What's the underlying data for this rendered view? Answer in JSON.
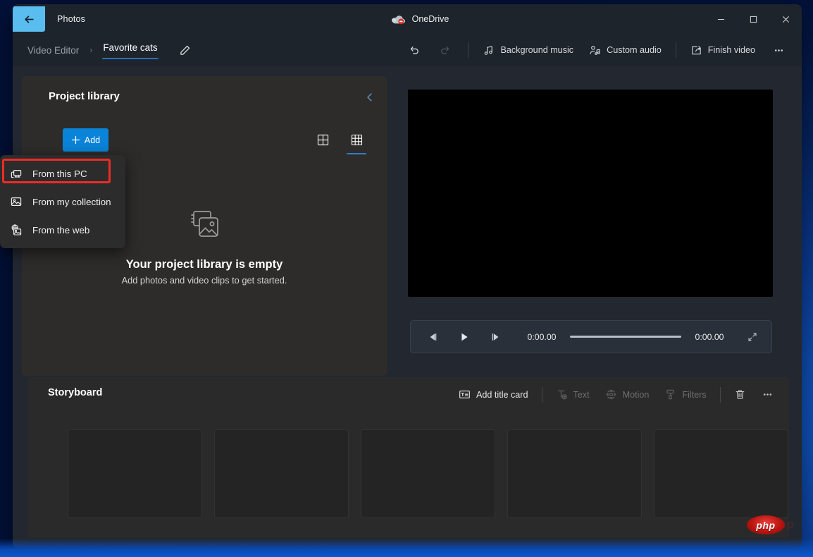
{
  "window": {
    "app_title": "Photos",
    "back_icon": "back-arrow-icon",
    "onedrive_label": "OneDrive",
    "onedrive_icon": "onedrive-cloud-icon",
    "minimize_label": "Minimize",
    "maximize_label": "Maximize",
    "close_label": "Close",
    "accent_blue": "#59bdf0",
    "window_bg": "#232830",
    "titlebar_bg": "#1e242c"
  },
  "breadcrumb": {
    "parent": "Video Editor",
    "separator": "›",
    "current": "Favorite cats",
    "edit_icon": "pencil-icon",
    "underline_color": "#2f6fb8"
  },
  "toolbar": {
    "undo_label": "Undo",
    "undo_icon": "undo-arrow-icon",
    "redo_label": "Redo",
    "redo_icon": "redo-arrow-icon",
    "redo_disabled": true,
    "items": [
      {
        "label": "Background music",
        "icon": "music-note-icon",
        "disabled": false
      },
      {
        "label": "Custom audio",
        "icon": "person-audio-icon",
        "disabled": false
      },
      {
        "label": "Finish video",
        "icon": "export-share-icon",
        "disabled": false
      }
    ],
    "more_label": "See more",
    "more_icon": "ellipsis-icon"
  },
  "library": {
    "title": "Project library",
    "collapse_icon": "chevron-left-icon",
    "add_label": "Add",
    "add_icon": "plus-icon",
    "add_color": "#0a84d8",
    "views": [
      {
        "name": "large-grid-view",
        "icon": "grid-2x2-icon",
        "selected": false
      },
      {
        "name": "small-grid-view",
        "icon": "grid-3x3-icon",
        "selected": true
      }
    ],
    "empty_icon": "photo-stack-icon",
    "empty_title": "Your project library is empty",
    "empty_subtitle": "Add photos and video clips to get started."
  },
  "add_menu": {
    "open": true,
    "highlight_color": "#ee2b26",
    "items": [
      {
        "label": "From this PC",
        "icon": "monitor-pc-icon",
        "highlighted": true
      },
      {
        "label": "From my collection",
        "icon": "image-icon",
        "highlighted": false
      },
      {
        "label": "From the web",
        "icon": "web-image-icon",
        "highlighted": false
      }
    ]
  },
  "preview": {
    "video_background": "#000000",
    "prev_frame_icon": "previous-frame-icon",
    "play_icon": "play-icon",
    "next_frame_icon": "next-frame-icon",
    "current_time": "0:00.00",
    "total_time": "0:00.00",
    "progress_percent": 0,
    "fullscreen_icon": "expand-icon"
  },
  "storyboard": {
    "title": "Storyboard",
    "tools": [
      {
        "label": "Add title card",
        "icon": "title-card-icon",
        "disabled": false
      },
      {
        "label": "Text",
        "icon": "text-add-icon",
        "disabled": true
      },
      {
        "label": "Motion",
        "icon": "motion-icon",
        "disabled": true
      },
      {
        "label": "Filters",
        "icon": "filters-brush-icon",
        "disabled": true
      }
    ],
    "delete_label": "Delete",
    "delete_icon": "trash-icon",
    "more_label": "See more",
    "more_icon": "ellipsis-icon",
    "card_count": 5,
    "card_placeholder_label": ""
  },
  "watermark": {
    "text": "php",
    "ghost_text": "php"
  }
}
